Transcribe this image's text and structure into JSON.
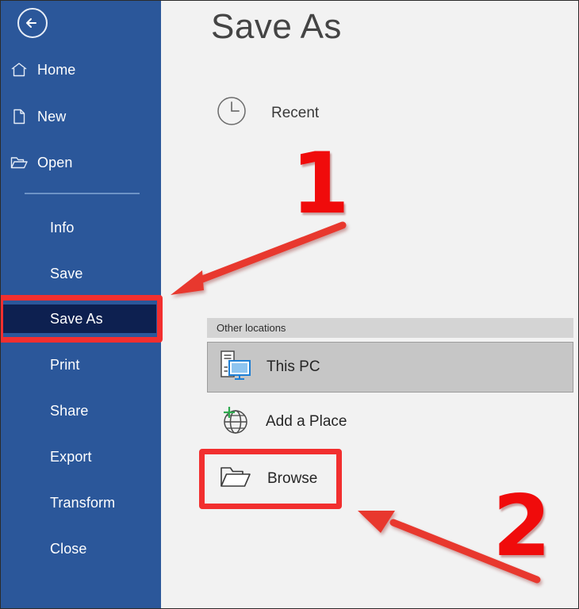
{
  "window": {
    "title": "Save As",
    "background": "#f2f2f2"
  },
  "colors": {
    "sidebar_blue": "#2b579a",
    "selected_navy": "#0d2050",
    "annotation_red": "#f22f2f",
    "number_red": "#f00b0b",
    "header_gray": "#d4d4d4",
    "row_selected_gray": "#c6c6c6",
    "accent_blue_icon": "#1f7fd4",
    "plus_green": "#2eaa4e"
  },
  "sidebar": {
    "back_button": {
      "name": "back-button",
      "icon": "back-arrow-circle-icon"
    },
    "top_items": [
      {
        "label": "Home",
        "icon": "home-icon"
      },
      {
        "label": "New",
        "icon": "document-icon"
      },
      {
        "label": "Open",
        "icon": "folder-open-icon"
      }
    ],
    "items": [
      {
        "label": "Info",
        "selected": false
      },
      {
        "label": "Save",
        "selected": false
      },
      {
        "label": "Save As",
        "selected": true
      },
      {
        "label": "Print",
        "selected": false
      },
      {
        "label": "Share",
        "selected": false
      },
      {
        "label": "Export",
        "selected": false
      },
      {
        "label": "Transform",
        "selected": false
      },
      {
        "label": "Close",
        "selected": false
      }
    ]
  },
  "main": {
    "title": "Save As",
    "recent": {
      "label": "Recent",
      "icon": "clock-icon"
    },
    "other_locations": {
      "header": "Other locations",
      "rows": [
        {
          "label": "This PC",
          "icon": "this-pc-icon",
          "selected": true
        },
        {
          "label": "Add a Place",
          "icon": "globe-plus-icon",
          "selected": false
        },
        {
          "label": "Browse",
          "icon": "folder-icon",
          "selected": false
        }
      ]
    }
  },
  "annotations": {
    "step_one": {
      "number": "1",
      "points_to": "Save As",
      "arrow": "arrow-down-left-icon"
    },
    "step_two": {
      "number": "2",
      "points_to": "Browse",
      "arrow": "arrow-up-left-icon"
    }
  }
}
